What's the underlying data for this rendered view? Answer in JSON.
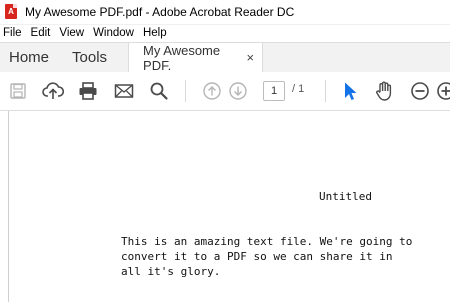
{
  "window": {
    "title": "My Awesome PDF.pdf - Adobe Acrobat Reader DC",
    "app_icon": "acrobat-reader-icon",
    "brand_color": "#d7261e"
  },
  "menubar": {
    "items": [
      {
        "label": "File"
      },
      {
        "label": "Edit"
      },
      {
        "label": "View"
      },
      {
        "label": "Window"
      },
      {
        "label": "Help"
      }
    ]
  },
  "tabs": {
    "home": "Home",
    "tools": "Tools",
    "document": "My Awesome PDF.",
    "close": "×"
  },
  "toolbar": {
    "icons": [
      "save-icon",
      "upload-icon",
      "print-icon",
      "email-icon",
      "search-icon",
      "page-up-icon",
      "page-down-icon",
      "select-cursor-icon",
      "hand-tool-icon",
      "zoom-out-icon",
      "zoom-in-icon"
    ],
    "current_page": "1",
    "page_total": "/ 1",
    "active_tool_color": "#1473e6"
  },
  "document": {
    "heading": "Untitled",
    "lines": [
      "This is an amazing text file. We're going to",
      "convert it to a PDF so we can share it in",
      "all it's glory."
    ]
  }
}
